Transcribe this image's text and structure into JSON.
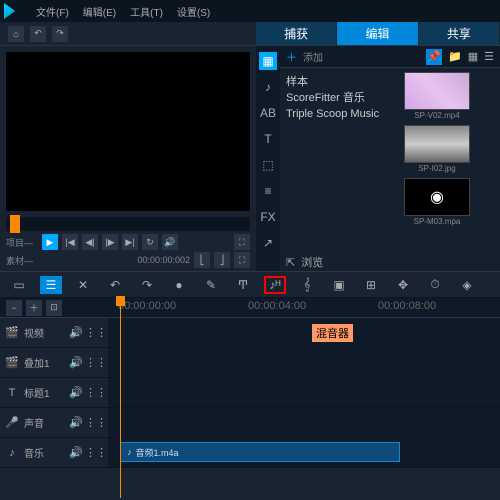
{
  "menu": {
    "file": "文件(F)",
    "edit": "编辑(E)",
    "tools": "工具(T)",
    "settings": "设置(S)"
  },
  "tabs": {
    "capture": "捕获",
    "edit": "编辑",
    "share": "共享"
  },
  "preview": {
    "project": "项目—",
    "material": "素材—",
    "timecode": "00:00:00:002"
  },
  "library": {
    "add": "添加",
    "items": [
      "样本",
      "ScoreFitter 音乐",
      "Triple Scoop Music"
    ],
    "thumbs": [
      {
        "name": "SP-V02.mp4"
      },
      {
        "name": "SP-I02.jpg"
      },
      {
        "name": "SP-M03.mpa"
      }
    ],
    "browse": "浏览"
  },
  "ruler": {
    "ticks": [
      "00:00:00:00",
      "00:00:04:00",
      "00:00:08:00"
    ]
  },
  "tracks": [
    {
      "name": "视频"
    },
    {
      "name": "叠加1"
    },
    {
      "name": "标题1"
    },
    {
      "name": "声音"
    },
    {
      "name": "音乐"
    }
  ],
  "clip": {
    "name": "音频1.m4a"
  },
  "callout": "混音器"
}
